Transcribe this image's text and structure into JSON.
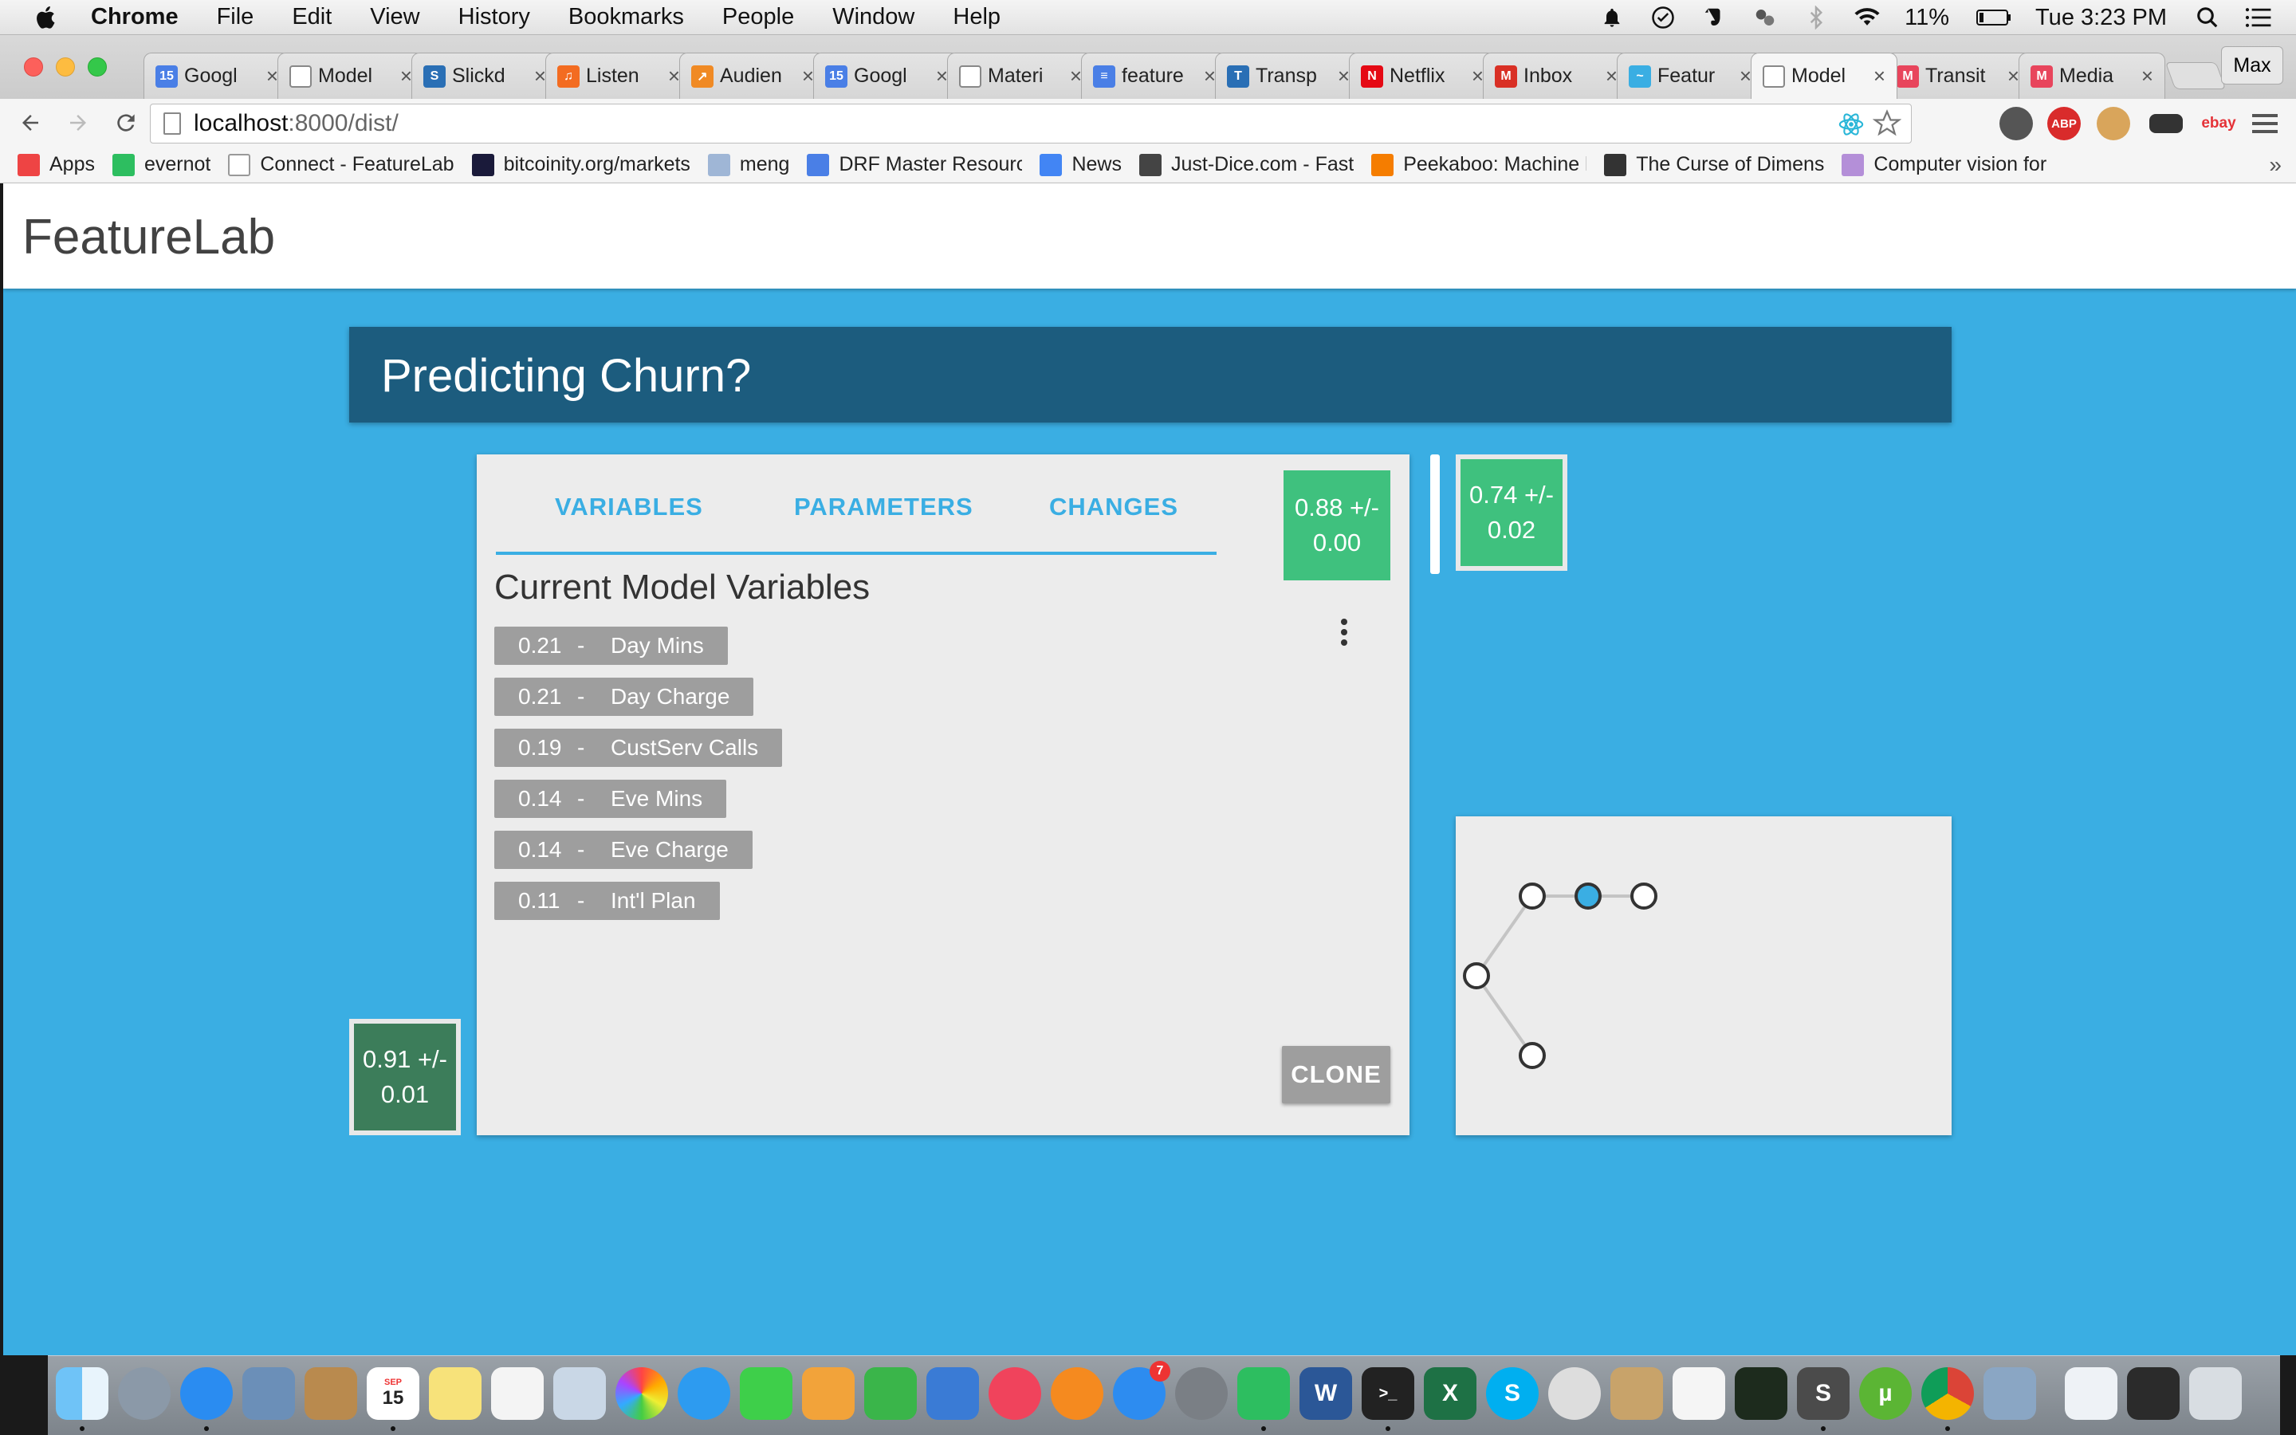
{
  "menubar": {
    "app_name": "Chrome",
    "menus": [
      "File",
      "Edit",
      "View",
      "History",
      "Bookmarks",
      "People",
      "Window",
      "Help"
    ],
    "battery": "11%",
    "clock": "Tue 3:23 PM"
  },
  "browser": {
    "tabs": [
      {
        "label": "Googl",
        "icon": "google-calendar-icon",
        "color": "#4a7fe6",
        "glyph": "15"
      },
      {
        "label": "Model",
        "icon": "page-icon",
        "color": "#ffffff",
        "glyph": ""
      },
      {
        "label": "Slickd",
        "icon": "slickdeals-icon",
        "color": "#2a6fb5",
        "glyph": "S"
      },
      {
        "label": "Listen",
        "icon": "headphones-icon",
        "color": "#f36c21",
        "glyph": "♫"
      },
      {
        "label": "Audien",
        "icon": "analytics-icon",
        "color": "#f08a24",
        "glyph": "↗"
      },
      {
        "label": "Googl",
        "icon": "google-calendar-icon",
        "color": "#4a7fe6",
        "glyph": "15"
      },
      {
        "label": "Materi",
        "icon": "page-icon",
        "color": "#ffffff",
        "glyph": ""
      },
      {
        "label": "feature",
        "icon": "google-docs-icon",
        "color": "#4a7fe6",
        "glyph": "≡"
      },
      {
        "label": "Transp",
        "icon": "transperfect-icon",
        "color": "#2a6fb5",
        "glyph": "T"
      },
      {
        "label": "Netflix",
        "icon": "netflix-icon",
        "color": "#e50914",
        "glyph": "N"
      },
      {
        "label": "Inbox",
        "icon": "gmail-icon",
        "color": "#d93025",
        "glyph": "M"
      },
      {
        "label": "Featur",
        "icon": "featurelab-icon",
        "color": "#3aaee3",
        "glyph": "~"
      },
      {
        "label": "Model",
        "icon": "page-icon",
        "color": "#ffffff",
        "glyph": "",
        "active": true
      },
      {
        "label": "Transit",
        "icon": "medium-icon",
        "color": "#e8455c",
        "glyph": "M"
      },
      {
        "label": "Media",
        "icon": "medium-icon",
        "color": "#e8455c",
        "glyph": "M"
      }
    ],
    "profile_name": "Max",
    "url_host": "localhost",
    "url_path": ":8000/dist/",
    "bookmarks": [
      {
        "label": "Apps",
        "icon": "apps-grid-icon",
        "color": "#e44"
      },
      {
        "label": "evernot",
        "icon": "evernote-icon",
        "color": "#2dbe60"
      },
      {
        "label": "Connect - FeatureLab",
        "icon": "page-icon",
        "color": "#ffffff"
      },
      {
        "label": "bitcoinity.org/markets",
        "icon": "bitcoinity-icon",
        "color": "#1a1a3a"
      },
      {
        "label": "meng",
        "icon": "folder-icon",
        "color": "#9fb6d6"
      },
      {
        "label": "DRF Master Resourc",
        "icon": "document-icon",
        "color": "#4a7fe6"
      },
      {
        "label": "News",
        "icon": "google-icon",
        "color": "#4285f4"
      },
      {
        "label": "Just-Dice.com - Fast",
        "icon": "dice-icon",
        "color": "#444444"
      },
      {
        "label": "Peekaboo: Machine l",
        "icon": "blogger-icon",
        "color": "#f57d00"
      },
      {
        "label": "The Curse of Dimens",
        "icon": "film-icon",
        "color": "#333333"
      },
      {
        "label": "Computer vision for",
        "icon": "layers-icon",
        "color": "#b48fd8"
      }
    ]
  },
  "app": {
    "brand": "FeatureLab",
    "question": "Predicting Churn?",
    "tabs": [
      "VARIABLES",
      "PARAMETERS",
      "CHANGES"
    ],
    "section_title": "Current Model Variables",
    "variables": [
      {
        "weight": "0.21",
        "name": "Day Mins"
      },
      {
        "weight": "0.21",
        "name": "Day Charge"
      },
      {
        "weight": "0.19",
        "name": "CustServ Calls"
      },
      {
        "weight": "0.14",
        "name": "Eve Mins"
      },
      {
        "weight": "0.14",
        "name": "Eve Charge"
      },
      {
        "weight": "0.11",
        "name": "Int'l Plan"
      }
    ],
    "separator": "-",
    "clone_label": "CLONE",
    "scores": {
      "current": {
        "line1": "0.88 +/-",
        "line2": "0.00"
      },
      "next": {
        "line1": "0.74 +/-",
        "line2": "0.02"
      },
      "previous": {
        "line1": "0.91 +/-",
        "line2": "0.01"
      }
    },
    "colors": {
      "page": "#3aaee3",
      "header": "#1c5c7e",
      "score": "#3fc17e",
      "score_dark": "#3c7d5a",
      "node_active": "#3aaee3"
    },
    "graph": {
      "nodes": [
        {
          "id": "root",
          "active": false
        },
        {
          "id": "a",
          "active": false
        },
        {
          "id": "b",
          "active": true
        },
        {
          "id": "c",
          "active": false
        },
        {
          "id": "d",
          "active": false
        }
      ],
      "edges": [
        [
          "root",
          "a"
        ],
        [
          "a",
          "b"
        ],
        [
          "b",
          "c"
        ],
        [
          "root",
          "d"
        ]
      ]
    }
  },
  "dock": {
    "badge": "7",
    "calendar_month": "SEP",
    "calendar_day": "15"
  }
}
